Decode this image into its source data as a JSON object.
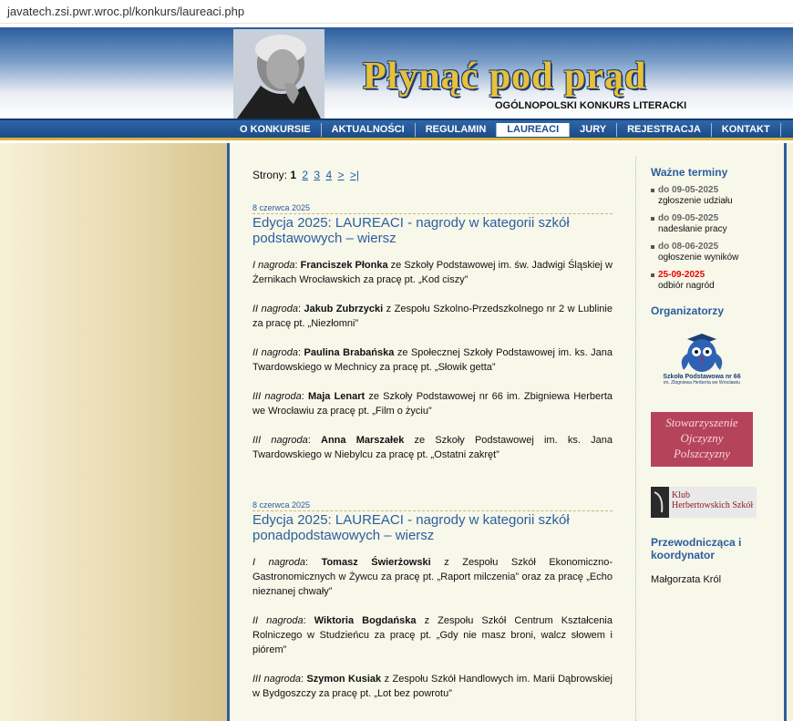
{
  "browser": {
    "url": "javatech.zsi.pwr.wroc.pl/konkurs/laureaci.php"
  },
  "header": {
    "title": "Płynąć pod prąd",
    "subtitle": "OGÓLNOPOLSKI KONKURS LITERACKI"
  },
  "nav": {
    "items": [
      {
        "label": "O KONKURSIE"
      },
      {
        "label": "AKTUALNOŚCI"
      },
      {
        "label": "REGULAMIN"
      },
      {
        "label": "LAUREACI"
      },
      {
        "label": "JURY"
      },
      {
        "label": "REJESTRACJA"
      },
      {
        "label": "KONTAKT"
      }
    ],
    "active": "LAUREACI"
  },
  "pager": {
    "label": "Strony",
    "current": "1",
    "pages": [
      "2",
      "3",
      "4",
      ">",
      ">|"
    ]
  },
  "posts": [
    {
      "date": "8 czerwca 2025",
      "title": "Edycja 2025: LAUREACI - nagrody w kategorii szkół podstawowych – wiersz",
      "awards": [
        {
          "prize": "I nagroda",
          "name": "Franciszek Płonka",
          "text": " ze Szkoły Podstawowej im. św. Jadwigi Śląskiej w Żernikach Wrocławskich za pracę pt. „Kod ciszy”"
        },
        {
          "prize": "II nagroda",
          "name": "Jakub Zubrzycki",
          "text": " z Zespołu Szkolno-Przedszkolnego nr 2 w Lublinie za pracę pt. „Niezłomni”"
        },
        {
          "prize": "II nagroda",
          "name": "Paulina Brabańska",
          "text": " ze Społecznej Szkoły Podstawowej im. ks. Jana Twardowskiego w Mechnicy za pracę pt. „Słowik getta”"
        },
        {
          "prize": "III nagroda",
          "name": "Maja Lenart",
          "text": " ze Szkoły Podstawowej nr 66 im. Zbigniewa Herberta we Wrocławiu za pracę pt. „Film o życiu”"
        },
        {
          "prize": "III nagroda",
          "name": "Anna Marszałek",
          "text": " ze Szkoły Podstawowej im. ks. Jana Twardowskiego w Niebylcu za pracę pt. „Ostatni zakręt”"
        }
      ]
    },
    {
      "date": "8 czerwca 2025",
      "title": "Edycja 2025: LAUREACI - nagrody w kategorii szkół ponadpodstawowych – wiersz",
      "awards": [
        {
          "prize": "I nagroda",
          "name": "Tomasz Świerżowski",
          "text": " z Zespołu Szkół Ekonomiczno-Gastronomicznych w Żywcu za pracę pt. „Raport milczenia” oraz za pracę „Echo nieznanej chwały”"
        },
        {
          "prize": "II nagroda",
          "name": "Wiktoria Bogdańska",
          "text": " z Zespołu Szkół Centrum Kształcenia Rolniczego w Studzieńcu za pracę pt. „Gdy nie masz broni, walcz słowem i piórem”"
        },
        {
          "prize": "III nagroda",
          "name": "Szymon Kusiak",
          "text": " z Zespołu Szkół Handlowych im. Marii Dąbrowskiej w Bydgoszczy za pracę pt. „Lot bez powrotu”"
        }
      ]
    }
  ],
  "sidebar": {
    "terms_heading": "Ważne terminy",
    "terms": [
      {
        "date": "do 09-05-2025",
        "desc": "zgłoszenie udziału",
        "highlight": false
      },
      {
        "date": "do 09-05-2025",
        "desc": "nadesłanie pracy",
        "highlight": false
      },
      {
        "date": "do 08-06-2025",
        "desc": "ogłoszenie wyników",
        "highlight": false
      },
      {
        "date": "25-09-2025",
        "desc": "odbiór nagród",
        "highlight": true
      }
    ],
    "organizers_heading": "Organizatorzy",
    "org1": {
      "line1": "Szkoła Podstawowa nr 66",
      "line2": "im. Zbigniewa Herberta we Wrocławiu"
    },
    "org2": {
      "line1": "Stowarzyszenie",
      "line2": "Ojczyzny",
      "line3": "Polszczyzny"
    },
    "org3": {
      "line1": "Klub",
      "line2": "Herbertowskich Szkół"
    },
    "coordinator_heading": "Przewodnicząca i koordynator",
    "coordinator_name": "Małgorzata Król"
  },
  "colors": {
    "accent": "#2c5e9d",
    "gold": "#e8c03a",
    "highlight_red": "#e00000"
  }
}
